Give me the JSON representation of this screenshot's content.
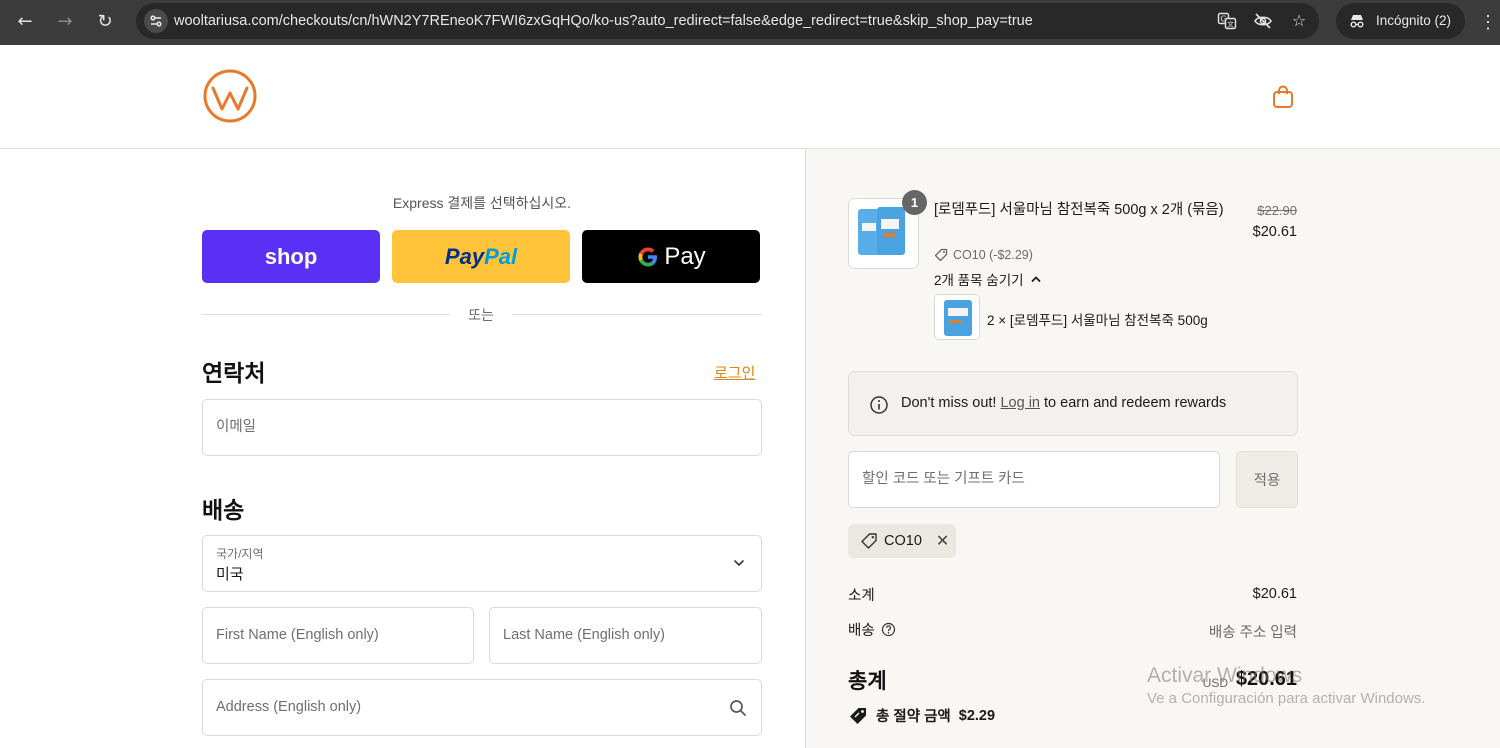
{
  "browser": {
    "url": "wooltariusa.com/checkouts/cn/hWN2Y7REneoK7FWI6zxGqHQo/ko-us?auto_redirect=false&edge_redirect=true&skip_shop_pay=true",
    "profile_label": "Incógnito (2)",
    "icons": [
      "back-icon",
      "forward-icon",
      "reload-icon",
      "site-info-icon",
      "translate-icon",
      "eye-off-icon",
      "star-icon",
      "incognito-icon",
      "kebab-menu-icon"
    ]
  },
  "header": {
    "logo_icon": "wooltari-logo",
    "cart_icon": "shopping-bag-icon",
    "accent_color": "#e8792c"
  },
  "express": {
    "title": "Express 결제를 선택하십시오.",
    "shop_label": "shop",
    "paypal_part1": "Pay",
    "paypal_part2": "Pal",
    "gpay_label": "Pay",
    "divider": "또는"
  },
  "contact": {
    "title": "연락처",
    "login_label": "로그인",
    "email_placeholder": "이메일"
  },
  "shipping": {
    "title": "배송",
    "country_label": "국가/지역",
    "country_value": "미국",
    "first_name_placeholder": "First Name (English only)",
    "last_name_placeholder": "Last Name (English only)",
    "address_placeholder": "Address (English only)"
  },
  "order": {
    "quantity": "1",
    "product_name": "[로뎀푸드] 서울마님 참전복죽 500g x 2개 (묶음)",
    "original_price": "$22.90",
    "price": "$20.61",
    "discount_line": "CO10 (-$2.29)",
    "hide_items_label": "2개 품목 숨기기",
    "sub_item": "2 × [로뎀푸드] 서울마님 참전복죽 500g"
  },
  "rewards": {
    "text_before": "Don't miss out!",
    "link": "Log in",
    "text_after": "to earn and redeem rewards"
  },
  "discount_code": {
    "placeholder": "할인 코드 또는 기프트 카드",
    "apply_label": "적용",
    "applied_code": "CO10"
  },
  "summary": {
    "subtotal_label": "소계",
    "subtotal_value": "$20.61",
    "shipping_label": "배송",
    "shipping_value": "배송 주소 입력",
    "total_label": "총계",
    "currency": "USD",
    "total_value": "$20.61",
    "savings_label": "총 절약 금액",
    "savings_value": "$2.29"
  },
  "watermark": {
    "line1": "Activar Windows",
    "line2": "Ve a Configuración para activar Windows."
  }
}
